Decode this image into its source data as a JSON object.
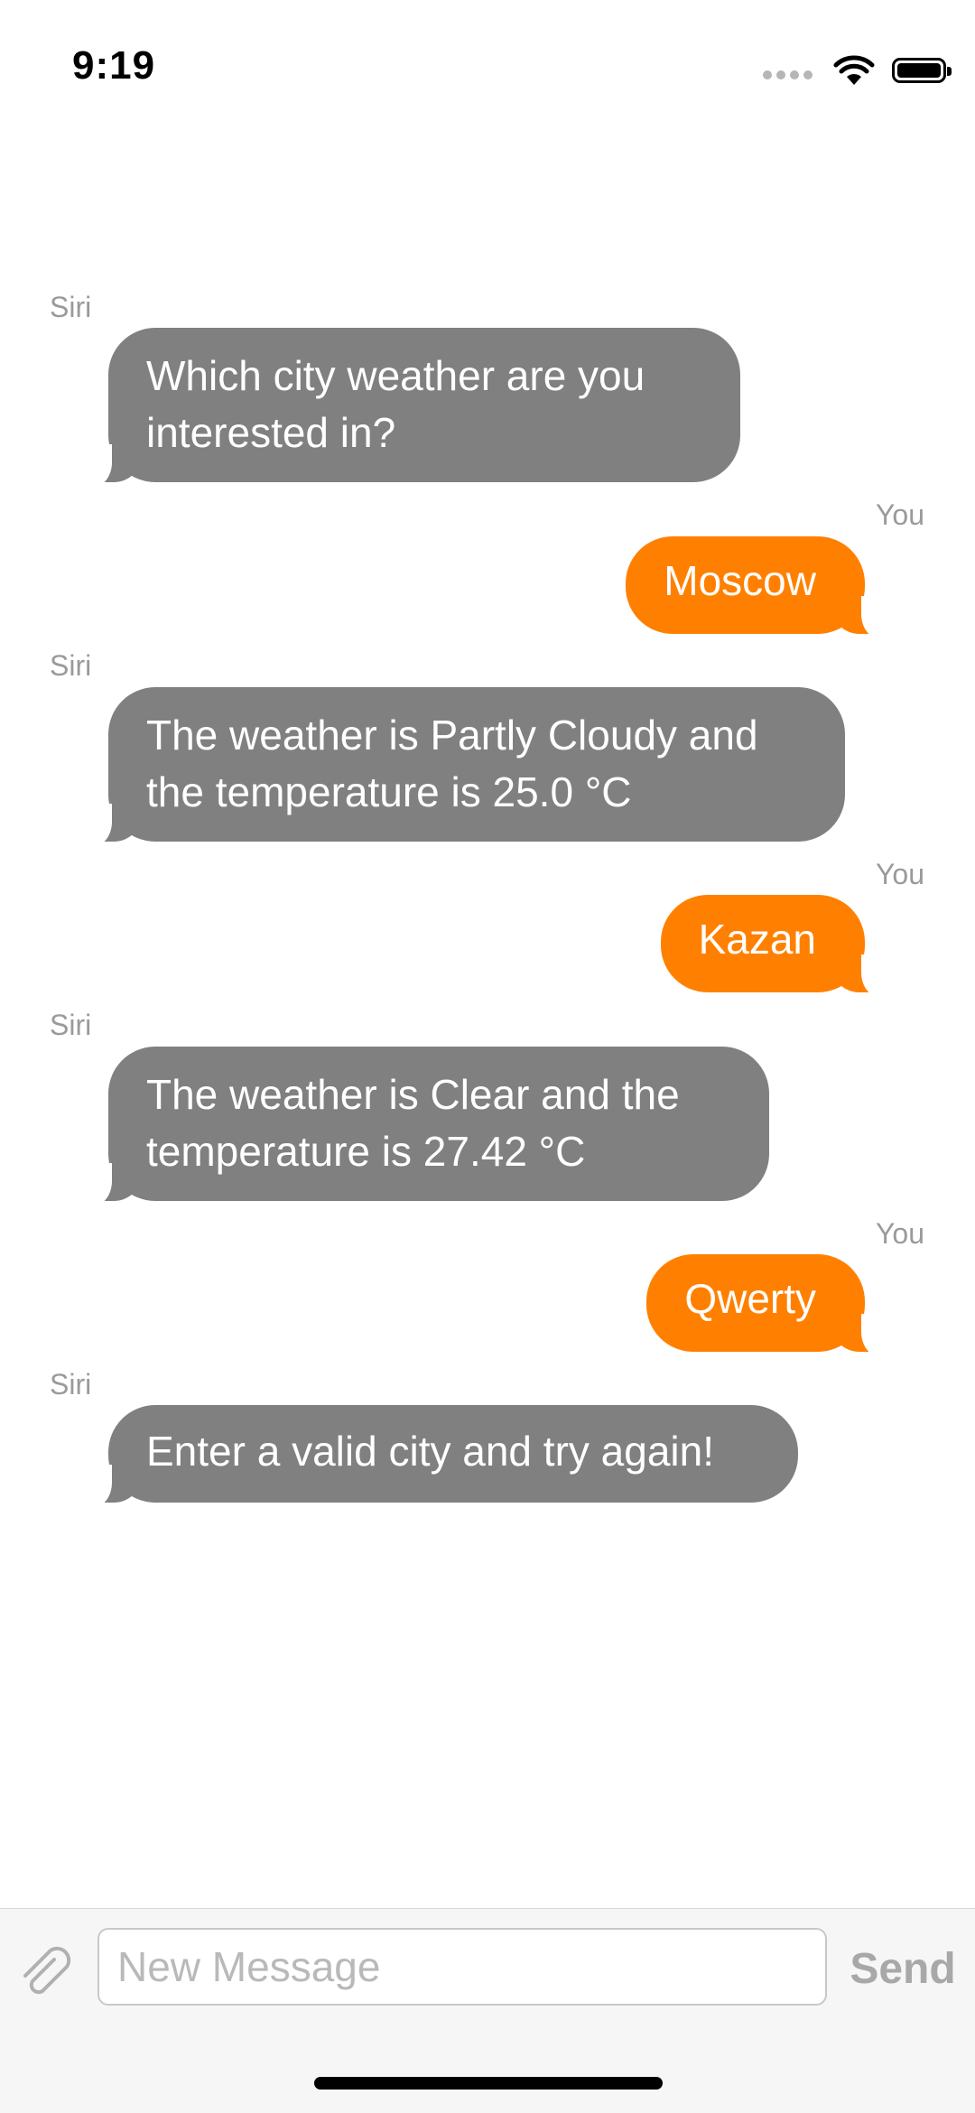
{
  "status_bar": {
    "time": "9:19"
  },
  "messages": [
    {
      "sender": "Siri",
      "text": "Which city weather are you interested in?"
    },
    {
      "sender": "You",
      "text": "Moscow"
    },
    {
      "sender": "Siri",
      "text": "The weather is Partly Cloudy and the temperature is 25.0 °C"
    },
    {
      "sender": "You",
      "text": "Kazan"
    },
    {
      "sender": "Siri",
      "text": "The weather is Clear and the temperature is 27.42 °C"
    },
    {
      "sender": "You",
      "text": "Qwerty"
    },
    {
      "sender": "Siri",
      "text": "Enter a valid city and try again!"
    }
  ],
  "composer": {
    "placeholder": "New Message",
    "value": "",
    "send_label": "Send"
  },
  "colors": {
    "siri_bubble": "#808080",
    "user_bubble": "#ff8000",
    "bubble_text": "#ffffff",
    "cursor": "#3a5bff"
  }
}
